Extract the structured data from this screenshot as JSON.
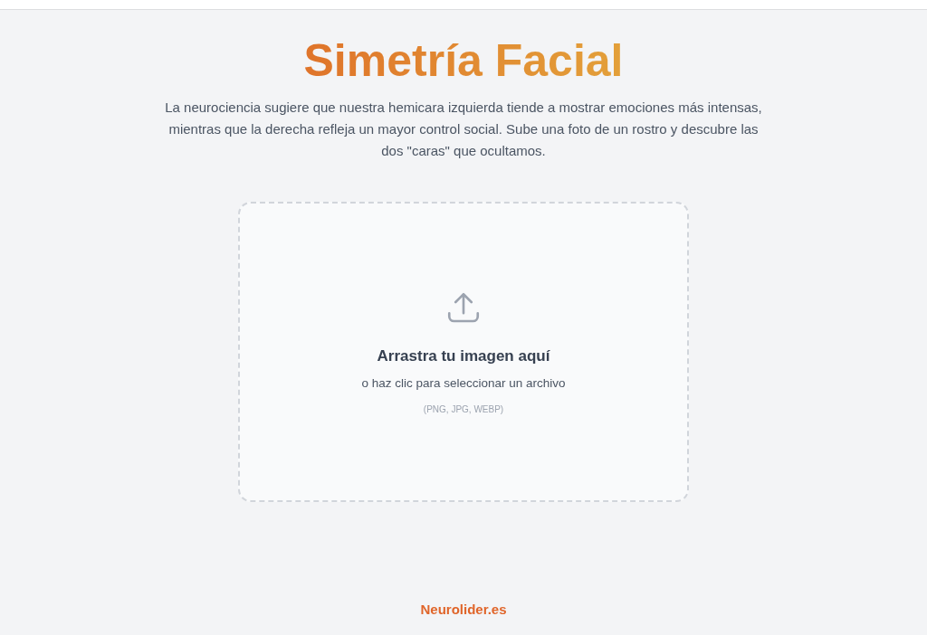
{
  "title": "Simetría Facial",
  "intro": "La neurociencia sugiere que nuestra hemicara izquierda tiende a mostrar emociones más intensas, mientras que la derecha refleja un mayor control social. Sube una foto de un rostro y descubre las dos \"caras\" que ocultamos.",
  "dropzone": {
    "heading": "Arrastra tu imagen aquí",
    "hint": "o haz clic para seleccionar un archivo",
    "formats": "(PNG, JPG, WEBP)"
  },
  "footer": {
    "link": "Neurolider.es"
  }
}
